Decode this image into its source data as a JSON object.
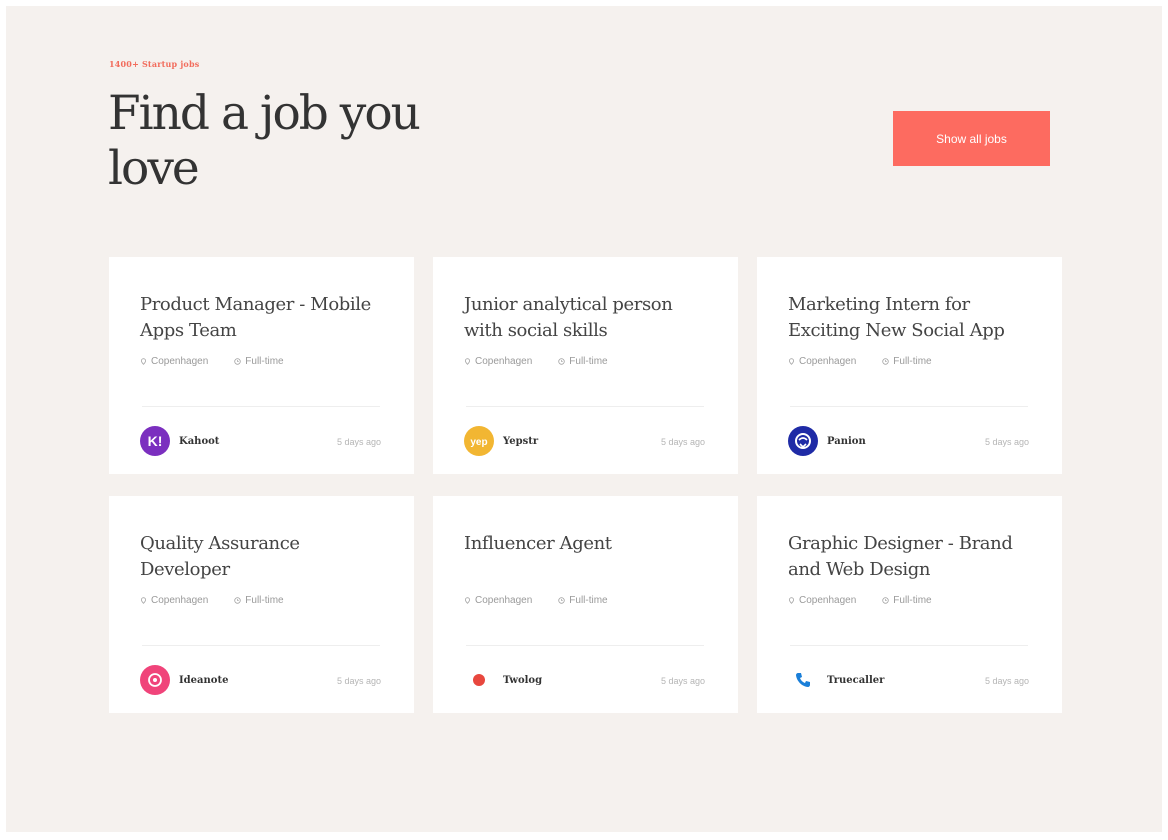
{
  "header": {
    "eyebrow": "1400+ Startup jobs",
    "title": "Find a job you love",
    "show_all_label": "Show all jobs"
  },
  "colors": {
    "accent": "#fd6b60",
    "background": "#f5f1ee",
    "card": "#ffffff"
  },
  "jobs": [
    {
      "title": "Product Manager - Mobile Apps Team",
      "location": "Copenhagen",
      "type": "Full-time",
      "company": "Kahoot",
      "posted": "5 days ago",
      "logo_icon": "kahoot-logo",
      "logo_color": "#7b2fbf"
    },
    {
      "title": "Junior analytical person with social skills",
      "location": "Copenhagen",
      "type": "Full-time",
      "company": "Yepstr",
      "posted": "5 days ago",
      "logo_icon": "yepstr-logo",
      "logo_color": "#f2b632"
    },
    {
      "title": "Marketing Intern for Exciting New Social App",
      "location": "Copenhagen",
      "type": "Full-time",
      "company": "Panion",
      "posted": "5 days ago",
      "logo_icon": "panion-logo",
      "logo_color": "#1f2ba6"
    },
    {
      "title": "Quality Assurance Developer",
      "location": "Copenhagen",
      "type": "Full-time",
      "company": "Ideanote",
      "posted": "5 days ago",
      "logo_icon": "ideanote-logo",
      "logo_color": "#f0447a"
    },
    {
      "title": "Influencer Agent",
      "location": "Copenhagen",
      "type": "Full-time",
      "company": "Twolog",
      "posted": "5 days ago",
      "logo_icon": "twolog-logo",
      "logo_color": "#e8473e"
    },
    {
      "title": "Graphic Designer - Brand and Web Design",
      "location": "Copenhagen",
      "type": "Full-time",
      "company": "Truecaller",
      "posted": "5 days ago",
      "logo_icon": "truecaller-logo",
      "logo_color": "#1a7fd9"
    }
  ]
}
